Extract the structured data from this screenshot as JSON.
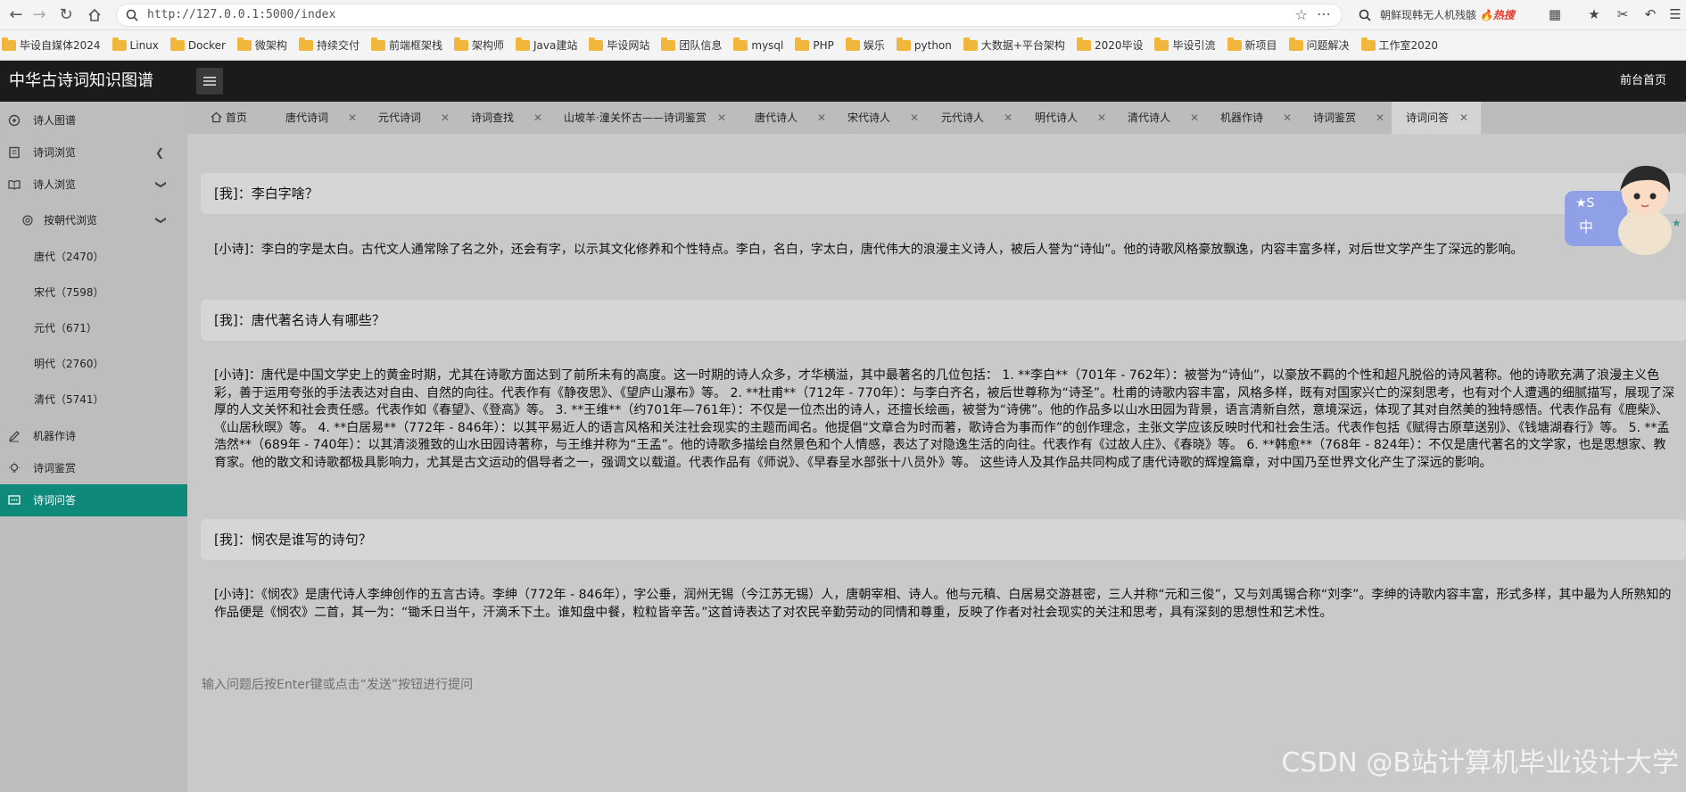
{
  "browser": {
    "url": "http://127.0.0.1:5000/index",
    "search_text": "朝鲜现韩无人机残骸",
    "search_hot_tag": "热搜"
  },
  "bookmarks": [
    "毕设自媒体2024",
    "Linux",
    "Docker",
    "微架构",
    "持续交付",
    "前端框架栈",
    "架构师",
    "Java建站",
    "毕设网站",
    "团队信息",
    "mysql",
    "PHP",
    "娱乐",
    "python",
    "大数据+平台架构",
    "2020毕设",
    "毕设引流",
    "新项目",
    "问题解决",
    "工作室2020"
  ],
  "header": {
    "title": "中华古诗词知识图谱",
    "frontpage": "前台首页"
  },
  "sidebar": {
    "items": [
      {
        "label": "诗人图谱",
        "icon": "graph-icon"
      },
      {
        "label": "诗词浏览",
        "icon": "book-icon"
      },
      {
        "label": "诗人浏览",
        "icon": "open-book-icon"
      },
      {
        "label": "按朝代浏览",
        "icon": "circle-icon"
      },
      {
        "label": "唐代（2470）"
      },
      {
        "label": "宋代（7598）"
      },
      {
        "label": "元代（671）"
      },
      {
        "label": "明代（2760）"
      },
      {
        "label": "清代（5741）"
      },
      {
        "label": "机器作诗",
        "icon": "pen-icon"
      },
      {
        "label": "诗词鉴赏",
        "icon": "bulb-icon"
      },
      {
        "label": "诗词问答",
        "icon": "chat-icon"
      }
    ]
  },
  "tabs": [
    {
      "label": "首页"
    },
    {
      "label": "唐代诗词"
    },
    {
      "label": "元代诗词"
    },
    {
      "label": "诗词查找"
    },
    {
      "label": "山坡羊·潼关怀古——诗词鉴赏"
    },
    {
      "label": "唐代诗人"
    },
    {
      "label": "宋代诗人"
    },
    {
      "label": "元代诗人"
    },
    {
      "label": "明代诗人"
    },
    {
      "label": "清代诗人"
    },
    {
      "label": "机器作诗"
    },
    {
      "label": "诗词鉴赏"
    },
    {
      "label": "诗词问答"
    }
  ],
  "chat": [
    {
      "question": "[我]：李白字啥？",
      "answer": "[小诗]：李白的字是太白。古代文人通常除了名之外，还会有字，以示其文化修养和个性特点。李白，名白，字太白，唐代伟大的浪漫主义诗人，被后人誉为“诗仙”。他的诗歌风格豪放飘逸，内容丰富多样，对后世文学产生了深远的影响。"
    },
    {
      "question": "[我]：唐代著名诗人有哪些？",
      "answer": "[小诗]：唐代是中国文学史上的黄金时期，尤其在诗歌方面达到了前所未有的高度。这一时期的诗人众多，才华横溢，其中最著名的几位包括： 1. **李白**（701年 - 762年）：被誉为“诗仙”，以豪放不羁的个性和超凡脱俗的诗风著称。他的诗歌充满了浪漫主义色彩，善于运用夸张的手法表达对自由、自然的向往。代表作有《静夜思》、《望庐山瀑布》等。 2. **杜甫**（712年 - 770年）：与李白齐名，被后世尊称为“诗圣”。杜甫的诗歌内容丰富，风格多样，既有对国家兴亡的深刻思考，也有对个人遭遇的细腻描写，展现了深厚的人文关怀和社会责任感。代表作如《春望》、《登高》等。 3. **王维**（约701年—761年）：不仅是一位杰出的诗人，还擅长绘画，被誉为“诗佛”。他的作品多以山水田园为背景，语言清新自然，意境深远，体现了其对自然美的独特感悟。代表作品有《鹿柴》、《山居秋暝》等。 4. **白居易**（772年 - 846年）：以其平易近人的语言风格和关注社会现实的主题而闻名。他提倡“文章合为时而著，歌诗合为事而作”的创作理念，主张文学应该反映时代和社会生活。代表作包括《赋得古原草送别》、《钱塘湖春行》等。 5. **孟浩然**（689年 - 740年）：以其清淡雅致的山水田园诗著称，与王维并称为“王孟”。他的诗歌多描绘自然景色和个人情感，表达了对隐逸生活的向往。代表作有《过故人庄》、《春晓》等。 6. **韩愈**（768年 - 824年）：不仅是唐代著名的文学家，也是思想家、教育家。他的散文和诗歌都极具影响力，尤其是古文运动的倡导者之一，强调文以载道。代表作品有《师说》、《早春呈水部张十八员外》等。 这些诗人及其作品共同构成了唐代诗歌的辉煌篇章，对中国乃至世界文化产生了深远的影响。"
    },
    {
      "question": "[我]：悯农是谁写的诗句？",
      "answer": "[小诗]：《悯农》是唐代诗人李绅创作的五言古诗。李绅（772年 - 846年），字公垂，润州无锡（今江苏无锡）人，唐朝宰相、诗人。他与元稹、白居易交游甚密，三人并称“元和三俊”，又与刘禹锡合称“刘李”。李绅的诗歌内容丰富，形式多样，其中最为人所熟知的作品便是《悯农》二首，其一为：“锄禾日当午，汗滴禾下土。谁知盘中餐，粒粒皆辛苦。”这首诗表达了对农民辛勤劳动的同情和尊重，反映了作者对社会现实的关注和思考，具有深刻的思想性和艺术性。"
    }
  ],
  "input": {
    "placeholder": "输入问题后按Enter键或点击“发送”按钮进行提问"
  },
  "watermark": "CSDN @B站计算机毕业设计大学",
  "colors": {
    "active_sidebar": "#0f8a7a",
    "header_bg": "#1b1b1b",
    "hot": "#e4372b"
  }
}
